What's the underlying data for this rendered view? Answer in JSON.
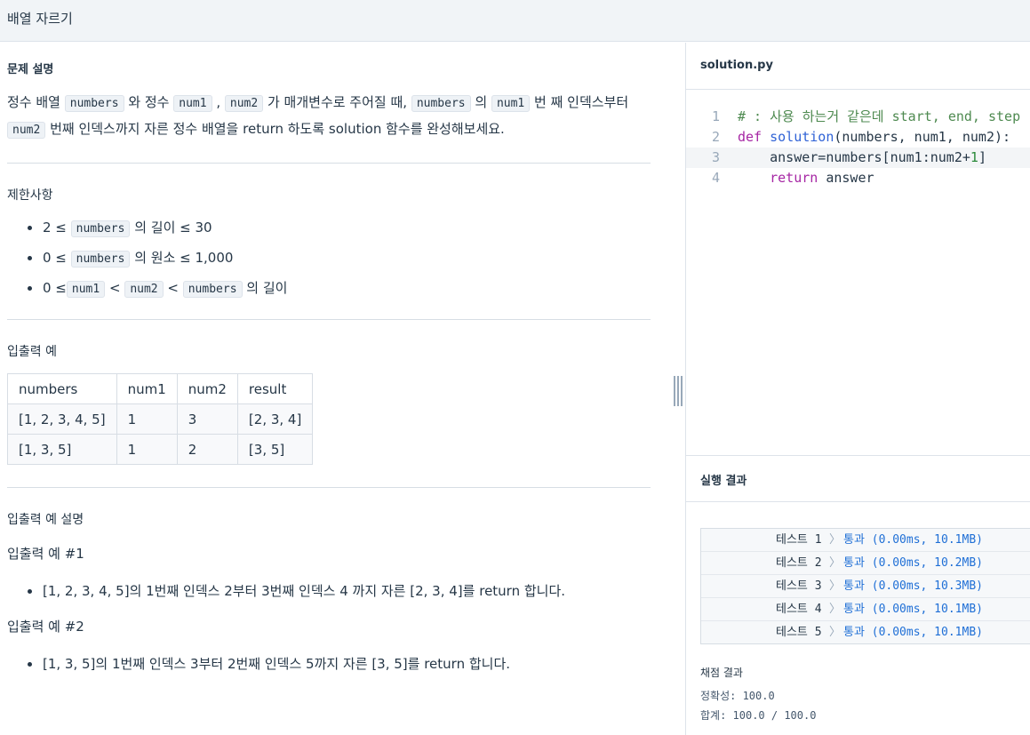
{
  "header": {
    "title": "배열 자르기"
  },
  "problem": {
    "desc_heading": "문제 설명",
    "desc": [
      {
        "t": "text",
        "v": "정수 배열 "
      },
      {
        "t": "code",
        "v": "numbers"
      },
      {
        "t": "text",
        "v": " 와 정수 "
      },
      {
        "t": "code",
        "v": "num1"
      },
      {
        "t": "text",
        "v": " , "
      },
      {
        "t": "code",
        "v": "num2"
      },
      {
        "t": "text",
        "v": " 가 매개변수로 주어질 때, "
      },
      {
        "t": "code",
        "v": "numbers"
      },
      {
        "t": "text",
        "v": " 의 "
      },
      {
        "t": "code",
        "v": "num1"
      },
      {
        "t": "text",
        "v": " 번 째 인덱스부터 "
      },
      {
        "t": "code",
        "v": "num2"
      },
      {
        "t": "text",
        "v": " 번째 인덱스까지 자른 정수 배열을 return 하도록 solution 함수를 완성해보세요."
      }
    ],
    "constraints_heading": "제한사항",
    "constraints": [
      [
        {
          "t": "text",
          "v": "2 ≤ "
        },
        {
          "t": "code",
          "v": "numbers"
        },
        {
          "t": "text",
          "v": " 의 길이 ≤ 30"
        }
      ],
      [
        {
          "t": "text",
          "v": "0 ≤ "
        },
        {
          "t": "code",
          "v": "numbers"
        },
        {
          "t": "text",
          "v": " 의 원소 ≤ 1,000"
        }
      ],
      [
        {
          "t": "text",
          "v": "0 ≤"
        },
        {
          "t": "code",
          "v": "num1"
        },
        {
          "t": "text",
          "v": " < "
        },
        {
          "t": "code",
          "v": "num2"
        },
        {
          "t": "text",
          "v": " < "
        },
        {
          "t": "code",
          "v": "numbers"
        },
        {
          "t": "text",
          "v": " 의 길이"
        }
      ]
    ],
    "io_heading": "입출력 예",
    "io_table": {
      "headers": [
        "numbers",
        "num1",
        "num2",
        "result"
      ],
      "rows": [
        [
          "[1, 2, 3, 4, 5]",
          "1",
          "3",
          "[2, 3, 4]"
        ],
        [
          "[1, 3, 5]",
          "1",
          "2",
          "[3, 5]"
        ]
      ]
    },
    "io_desc_heading": "입출력 예 설명",
    "example1_heading": "입출력 예 #1",
    "example1": "[1, 2, 3, 4, 5]의 1번째 인덱스 2부터 3번째 인덱스 4 까지 자른 [2, 3, 4]를 return 합니다.",
    "example2_heading": "입출력 예 #2",
    "example2": "[1, 3, 5]의 1번째 인덱스 3부터 2번째 인덱스 5까지 자른 [3, 5]를 return 합니다."
  },
  "editor": {
    "filename": "solution.py",
    "lines": [
      {
        "n": "1",
        "tokens": [
          {
            "c": "cm",
            "v": "# : 사용 하는거 같은데 start, end, step"
          }
        ]
      },
      {
        "n": "2",
        "tokens": [
          {
            "c": "kw",
            "v": "def"
          },
          {
            "c": "",
            "v": " "
          },
          {
            "c": "fn",
            "v": "solution"
          },
          {
            "c": "",
            "v": "(numbers, num1, num2):"
          }
        ]
      },
      {
        "n": "3",
        "tokens": [
          {
            "c": "",
            "v": "    answer=numbers[num1:num2+"
          },
          {
            "c": "nm",
            "v": "1"
          },
          {
            "c": "",
            "v": "]"
          }
        ]
      },
      {
        "n": "4",
        "tokens": [
          {
            "c": "",
            "v": "    "
          },
          {
            "c": "kw",
            "v": "return"
          },
          {
            "c": "",
            "v": " answer"
          }
        ]
      }
    ],
    "active_line": 3
  },
  "results": {
    "heading": "실행 결과",
    "tests": [
      {
        "label": "테스트 1",
        "chevron": "〉",
        "result": "통과 (0.00ms, 10.1MB)"
      },
      {
        "label": "테스트 2",
        "chevron": "〉",
        "result": "통과 (0.00ms, 10.2MB)"
      },
      {
        "label": "테스트 3",
        "chevron": "〉",
        "result": "통과 (0.00ms, 10.3MB)"
      },
      {
        "label": "테스트 4",
        "chevron": "〉",
        "result": "통과 (0.00ms, 10.1MB)"
      },
      {
        "label": "테스트 5",
        "chevron": "〉",
        "result": "통과 (0.00ms, 10.1MB)"
      }
    ],
    "grade_heading": "채점 결과",
    "accuracy": "정확성: 100.0",
    "total": "합계: 100.0 / 100.0"
  }
}
